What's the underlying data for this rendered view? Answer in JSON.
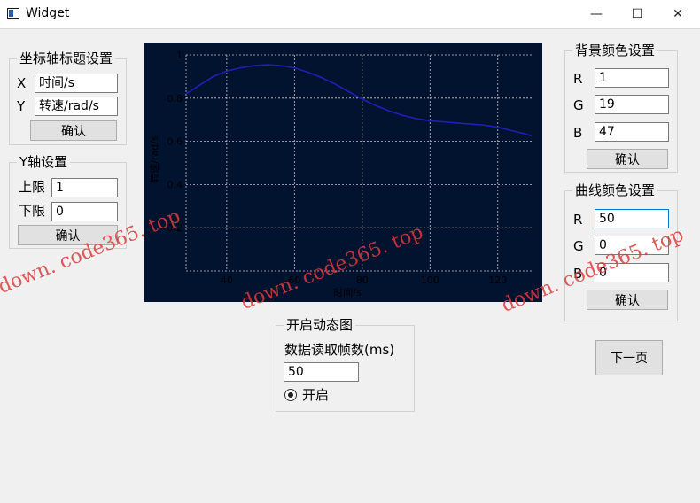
{
  "window": {
    "title": "Widget",
    "minimize": "—",
    "maximize": "☐",
    "close": "✕"
  },
  "axis_title_group": {
    "title": "坐标轴标题设置",
    "x_label": "X",
    "x_value": "时间/s",
    "y_label": "Y",
    "y_value": "转速/rad/s",
    "confirm": "确认"
  },
  "y_axis_group": {
    "title": "Y轴设置",
    "upper_label": "上限",
    "upper_value": "1",
    "lower_label": "下限",
    "lower_value": "0",
    "confirm": "确认"
  },
  "bg_color_group": {
    "title": "背景颜色设置",
    "r_label": "R",
    "r_value": "1",
    "g_label": "G",
    "g_value": "19",
    "b_label": "B",
    "b_value": "47",
    "confirm": "确认"
  },
  "curve_color_group": {
    "title": "曲线颜色设置",
    "r_label": "R",
    "r_value": "50",
    "g_label": "G",
    "g_value": "0",
    "b_label": "B",
    "b_value": "0",
    "confirm": "确认"
  },
  "dynamic_group": {
    "title": "开启动态图",
    "frame_label": "数据读取帧数(ms)",
    "frame_value": "50",
    "radio_label": "开启"
  },
  "next_button": "下一页",
  "watermark": "down. code365. top",
  "colors": {
    "chart_bg": "#01132f",
    "curve": "#1f1fb8",
    "grid": "#c8c8c8"
  },
  "chart_data": {
    "type": "line",
    "xlabel": "时间/s",
    "ylabel": "转速/rad/s",
    "xlim": [
      28,
      130
    ],
    "ylim": [
      0,
      1
    ],
    "x_ticks": [
      "40",
      "60",
      "80",
      "100",
      "120"
    ],
    "x_tick_values": [
      40,
      60,
      80,
      100,
      120
    ],
    "y_ticks": [
      "0.2",
      "0.4",
      "0.6",
      "0.8",
      "1"
    ],
    "y_tick_values": [
      0.2,
      0.4,
      0.6,
      0.8,
      1.0
    ],
    "grid": true,
    "series": [
      {
        "x": [
          28,
          32,
          36,
          40,
          44,
          48,
          52,
          56,
          60,
          64,
          68,
          72,
          76,
          80,
          84,
          88,
          92,
          96,
          100,
          104,
          108,
          112,
          116,
          120,
          124,
          128,
          130
        ],
        "values": [
          0.82,
          0.86,
          0.9,
          0.925,
          0.94,
          0.95,
          0.955,
          0.95,
          0.94,
          0.92,
          0.895,
          0.865,
          0.83,
          0.795,
          0.765,
          0.74,
          0.72,
          0.705,
          0.695,
          0.69,
          0.685,
          0.68,
          0.675,
          0.665,
          0.65,
          0.635,
          0.625
        ]
      }
    ]
  }
}
